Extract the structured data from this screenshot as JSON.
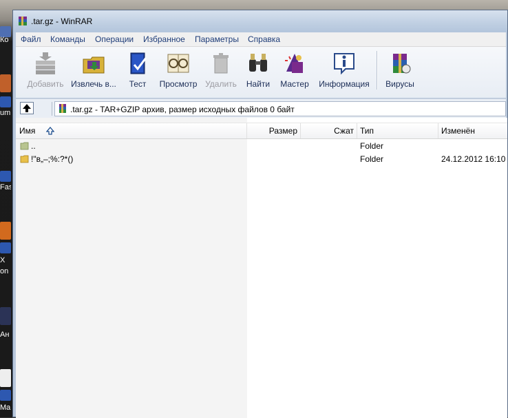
{
  "desktop": {
    "labels": [
      "Ко",
      "um",
      "Fas",
      "X",
      "on",
      "Ан",
      "Ma"
    ]
  },
  "window": {
    "title": ".tar.gz - WinRAR"
  },
  "menu": {
    "items": [
      "Файл",
      "Команды",
      "Операции",
      "Избранное",
      "Параметры",
      "Справка"
    ]
  },
  "toolbar": {
    "buttons": [
      {
        "label": "Добавить",
        "icon": "add-books-icon",
        "enabled": false
      },
      {
        "label": "Извлечь в...",
        "icon": "extract-folder-icon",
        "enabled": true
      },
      {
        "label": "Тест",
        "icon": "test-book-icon",
        "enabled": true
      },
      {
        "label": "Просмотр",
        "icon": "glasses-book-icon",
        "enabled": true
      },
      {
        "label": "Удалить",
        "icon": "trash-icon",
        "enabled": false
      },
      {
        "label": "Найти",
        "icon": "binoculars-icon",
        "enabled": true
      },
      {
        "label": "Мастер",
        "icon": "wizard-icon",
        "enabled": true
      },
      {
        "label": "Информация",
        "icon": "info-icon",
        "enabled": true
      },
      {
        "label": "Вирусы",
        "icon": "virus-scan-icon",
        "enabled": true
      }
    ]
  },
  "address": {
    "text": ".tar.gz - TAR+GZIP архив, размер исходных файлов 0 байт"
  },
  "columns": {
    "name": "Имя",
    "size": "Размер",
    "packed": "Сжат",
    "type": "Тип",
    "modified": "Изменён"
  },
  "rows": [
    {
      "name": "..",
      "size": "",
      "packed": "",
      "type": "Folder",
      "modified": ""
    },
    {
      "name": "!\"в„–;%:?*()",
      "size": "",
      "packed": "",
      "type": "Folder",
      "modified": "24.12.2012 16:10"
    }
  ],
  "colors": {
    "menu_text": "#1e3c78",
    "toolbar_text": "#1a2c55",
    "disabled_text": "#9a9aa0",
    "folder_yellow": "#e8c04a"
  }
}
